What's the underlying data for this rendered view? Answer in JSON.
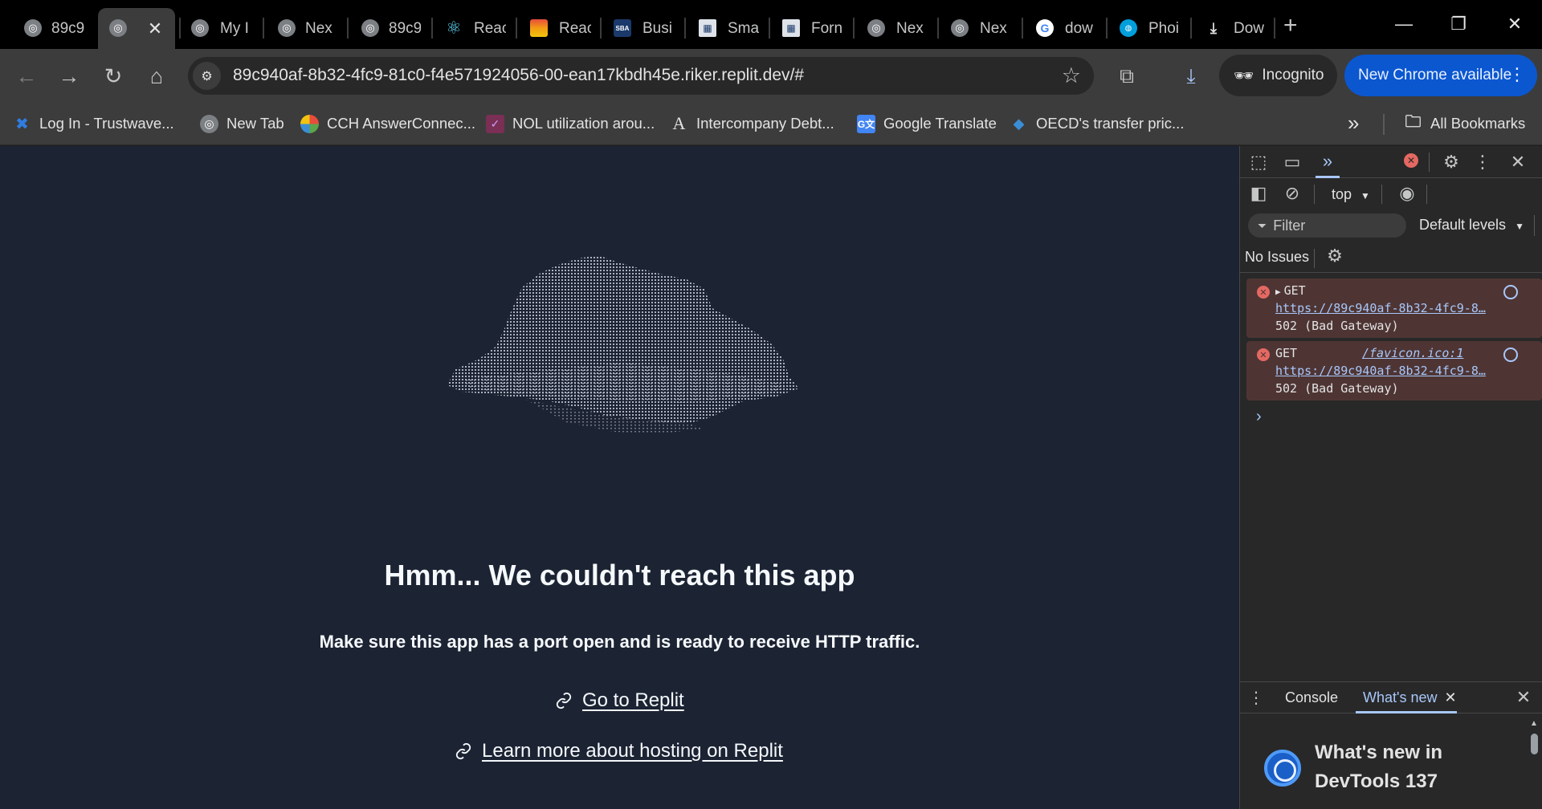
{
  "tabs": [
    {
      "label": "89c9",
      "icon": "globe-icon"
    },
    {
      "label": "",
      "icon": "globe-icon",
      "active": true
    },
    {
      "label": "My I",
      "icon": "globe-icon"
    },
    {
      "label": "Nex",
      "icon": "globe-icon"
    },
    {
      "label": "89c9",
      "icon": "globe-icon"
    },
    {
      "label": "Reac",
      "icon": "react-icon"
    },
    {
      "label": "Reac",
      "icon": "rainbow-icon"
    },
    {
      "label": "Busi",
      "icon": "sba-icon"
    },
    {
      "label": "Sma",
      "icon": "form-icon"
    },
    {
      "label": "Forn",
      "icon": "form-icon"
    },
    {
      "label": "Nex",
      "icon": "globe-icon"
    },
    {
      "label": "Nex",
      "icon": "globe-icon"
    },
    {
      "label": "dow",
      "icon": "google-icon"
    },
    {
      "label": "Phoi",
      "icon": "att-icon"
    },
    {
      "label": "Dow",
      "icon": "download-icon"
    }
  ],
  "toolbar": {
    "url": "89c940af-8b32-4fc9-81c0-f4e571924056-00-ean17kbdh45e.riker.replit.dev/#",
    "incognito_label": "Incognito",
    "update_label": "New Chrome available"
  },
  "bookmarks": [
    {
      "label": "Log In - Trustwave...",
      "icon": "trustwave-icon",
      "color": "#2f7de1"
    },
    {
      "label": "New Tab",
      "icon": "globe-icon",
      "color": "#7c7f83"
    },
    {
      "label": "CCH AnswerConnec...",
      "icon": "cch-icon",
      "color": "#5aa64a"
    },
    {
      "label": "NOL utilization arou...",
      "icon": "nol-icon",
      "color": "#7a2f55"
    },
    {
      "label": "Intercompany Debt...",
      "icon": "a-logo-icon",
      "color": "#e3e3e3"
    },
    {
      "label": "Google Translate",
      "icon": "translate-icon",
      "color": "#4285f4"
    },
    {
      "label": "OECD's transfer pric...",
      "icon": "oecd-icon",
      "color": "#3b8ed6"
    }
  ],
  "all_bookmarks_label": "All Bookmarks",
  "page": {
    "title": "Hmm... We couldn't reach this app",
    "subtitle": "Make sure this app has a port open and is ready to receive HTTP traffic.",
    "link1": "Go to Replit",
    "link2": "Learn more about hosting on Replit"
  },
  "devtools": {
    "context": "top",
    "filter_placeholder": "Filter",
    "levels": "Default levels",
    "no_issues": "No Issues",
    "errors": [
      {
        "method": "GET",
        "source": "",
        "url": "https://89c940af-8b32-4fc9-8…",
        "status": "502 (Bad Gateway)"
      },
      {
        "method": "GET",
        "source": "/favicon.ico:1",
        "url": "https://89c940af-8b32-4fc9-8…",
        "status": "502 (Bad Gateway)"
      }
    ],
    "drawer_tabs": [
      "Console",
      "What's new"
    ],
    "whats_new_line1": "What's new in",
    "whats_new_line2": "DevTools 137"
  },
  "colors": {
    "page_bg": "#1c2333",
    "update_button": "#0b57d0",
    "error_bg": "#4e3534"
  }
}
